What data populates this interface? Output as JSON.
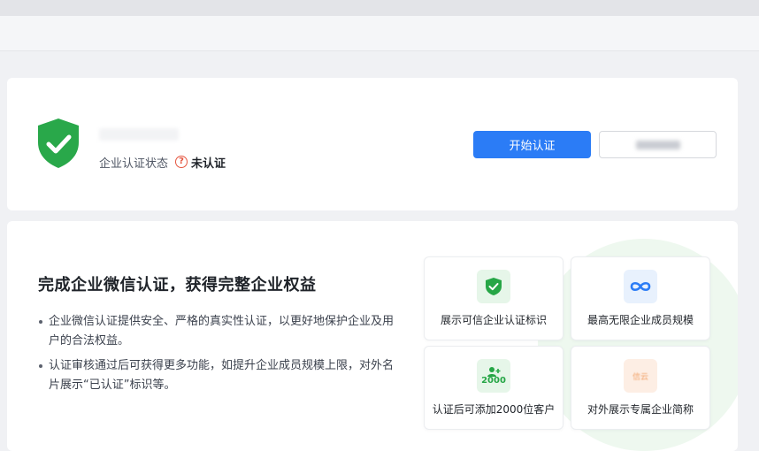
{
  "status_card": {
    "status_label": "企业认证状态",
    "status_value": "未认证",
    "start_button": "开始认证"
  },
  "info_card": {
    "title": "完成企业微信认证，获得完整企业权益",
    "bullets": [
      "企业微信认证提供安全、严格的真实性认证，以更好地保护企业及用户的合法权益。",
      "认证审核通过后可获得更多功能，如提升企业成员规模上限，对外名片展示“已认证”标识等。"
    ],
    "features": [
      {
        "label": "展示可信企业认证标识",
        "icon": "verified-shield-icon"
      },
      {
        "label": "最高无限企业成员规模",
        "icon": "infinity-icon"
      },
      {
        "label": "认证后可添加2000位客户",
        "icon": "customer-2000-icon",
        "badge": "2000"
      },
      {
        "label": "对外展示专属企业简称",
        "icon": "company-name-icon",
        "badge": "信云"
      }
    ]
  },
  "colors": {
    "primary": "#2b7cf6",
    "green": "#26a646",
    "warning": "#e5553f"
  }
}
